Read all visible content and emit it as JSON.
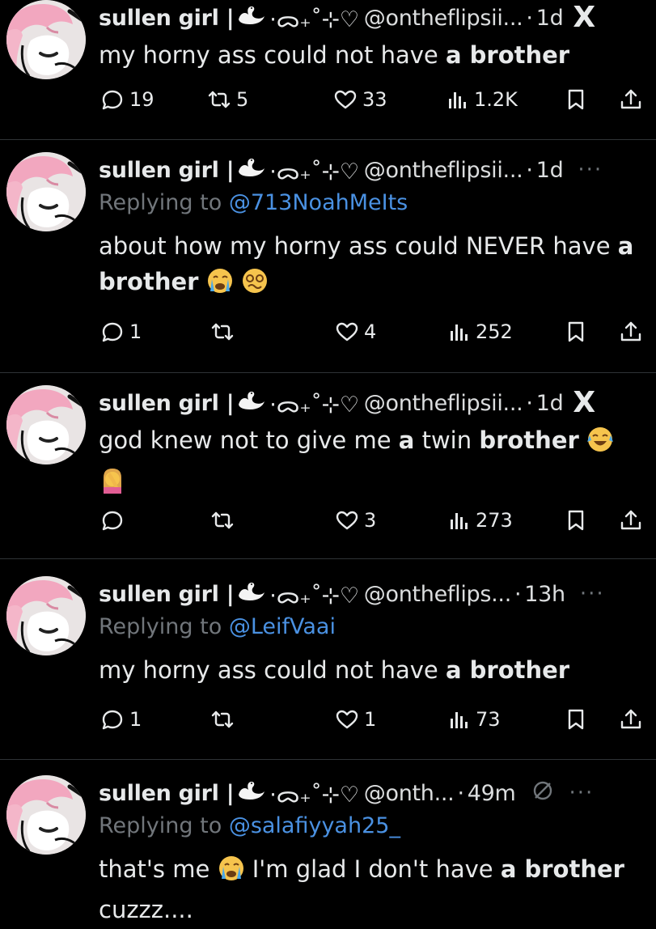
{
  "tweets": [
    {
      "name": "sullen girl | ",
      "deco": "·ᯅ₊˚⊹♡",
      "handle": "@ontheflipsii...",
      "time": "1d",
      "end_icon": "x-logo",
      "replying": null,
      "text_parts": [
        {
          "t": "my horny ass could not have ",
          "b": false
        },
        {
          "t": "a brother",
          "b": true
        }
      ],
      "replies": "19",
      "retweets": "5",
      "likes": "33",
      "views": "1.2K"
    },
    {
      "name": "sullen girl | ",
      "deco": "·ᯅ₊˚⊹♡",
      "handle": "@ontheflipsii...",
      "time": "1d",
      "end_icon": "more",
      "replying_label": "Replying to ",
      "replying_to": "@713NoahMeIts",
      "text_line1": "about how my horny ass could NEVER have ",
      "text_line1_bold": "a",
      "text_line2_bold": "brother",
      "emojis": [
        "crying-face-emoji",
        "woozy-face-emoji"
      ],
      "replies": "1",
      "retweets": "",
      "likes": "4",
      "views": "252"
    },
    {
      "name": "sullen girl | ",
      "deco": "·ᯅ₊˚⊹♡",
      "handle": "@ontheflipsii...",
      "time": "1d",
      "end_icon": "x-logo",
      "text_a": "god knew not to give me ",
      "text_b": "a",
      "text_c": " twin ",
      "text_d": "brother",
      "emojis": [
        "tears-of-joy-emoji",
        "facepalm-woman-emoji"
      ],
      "replies": "",
      "retweets": "",
      "likes": "3",
      "views": "273"
    },
    {
      "name": "sullen girl | ",
      "deco": "·ᯅ₊˚⊹♡",
      "handle": "@ontheflips...",
      "time": "13h",
      "end_icon": "more",
      "replying_label": "Replying to ",
      "replying_to": "@LeifVaai",
      "text_plain": "my horny ass could not have ",
      "text_bold": "a brother",
      "replies": "1",
      "retweets": "",
      "likes": "1",
      "views": "73"
    },
    {
      "name": "sullen girl | ",
      "deco": "·ᯅ₊˚⊹♡",
      "handle": "@onth...",
      "time": "49m",
      "end_icon": "more",
      "replying_label": "Replying to ",
      "replying_to": "@salafiyyah25_",
      "text_a": "that's me ",
      "text_b": " I'm glad I don't have ",
      "text_c": "a brother",
      "text_d": "cuzzz....",
      "emojis": [
        "crying-face-emoji"
      ]
    }
  ],
  "separator": "·",
  "more_glyph": "···",
  "x_glyph": "X",
  "colors": {
    "background": "#000000",
    "text": "#e7e9ea",
    "muted": "#71767b",
    "link": "#4a91e2",
    "divider": "#2f3336"
  }
}
